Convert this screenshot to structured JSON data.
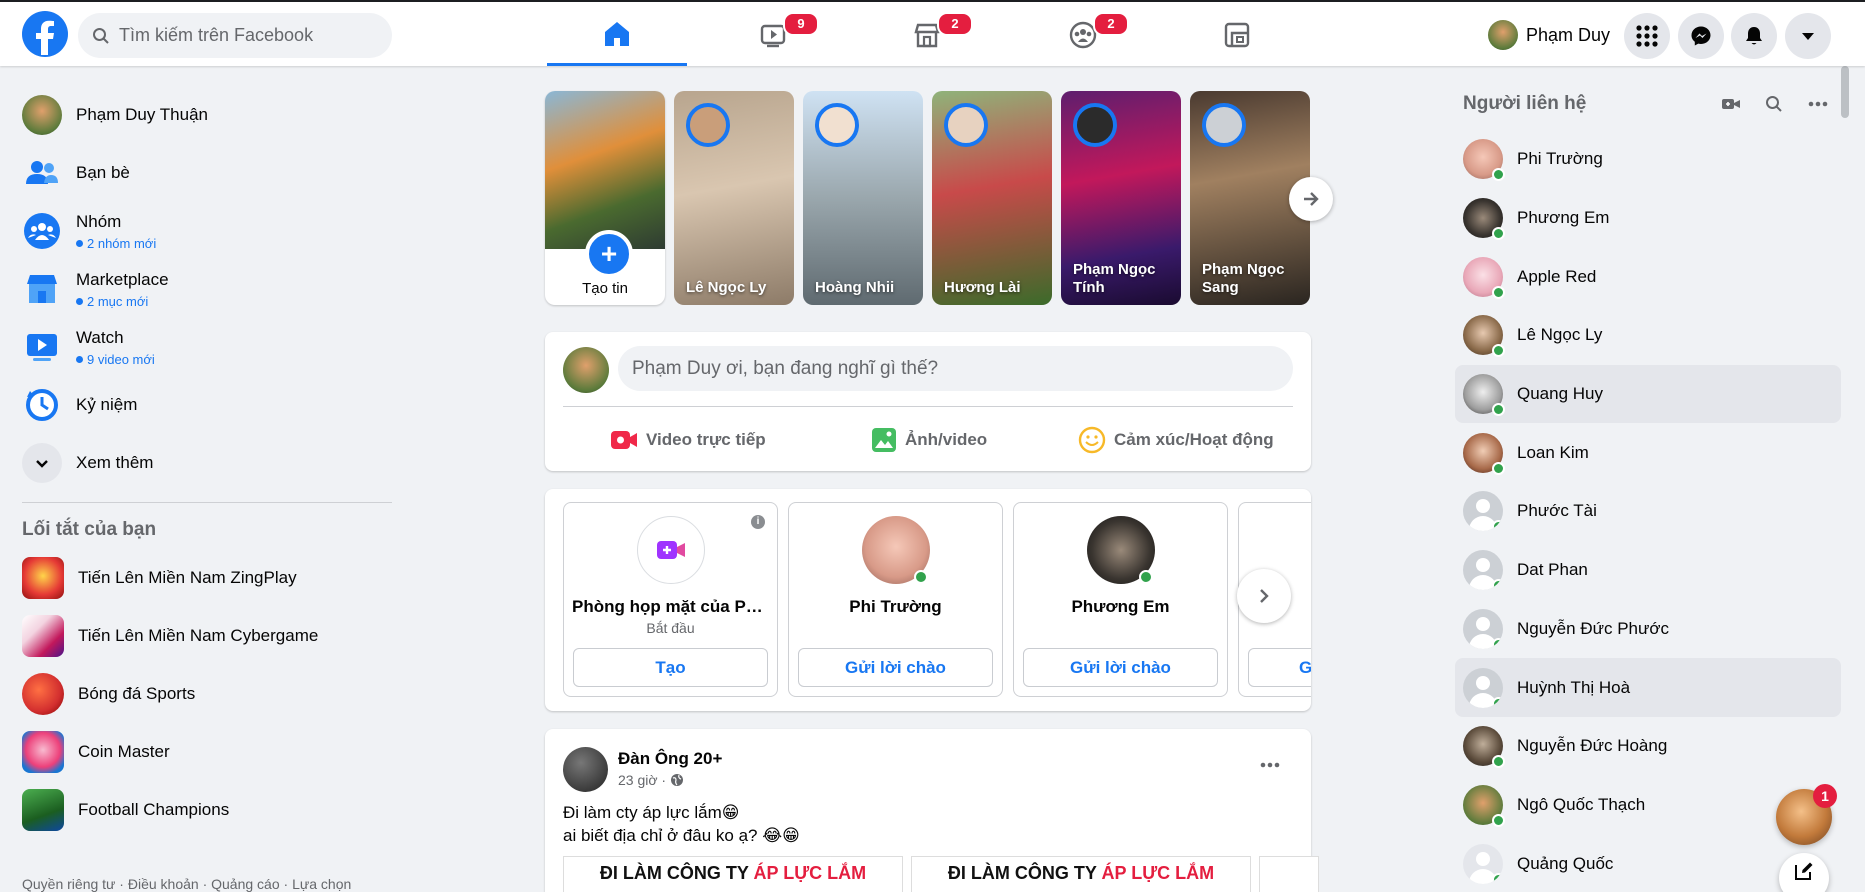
{
  "colors": {
    "brand": "#1877f2",
    "badge": "#e41e3f",
    "online": "#31a24c",
    "muted": "#65676b"
  },
  "search": {
    "placeholder": "Tìm kiếm trên Facebook"
  },
  "nav": {
    "tabs": [
      {
        "icon": "home-icon",
        "badge": ""
      },
      {
        "icon": "watch-icon",
        "badge": "9"
      },
      {
        "icon": "marketplace-icon",
        "badge": "2"
      },
      {
        "icon": "groups-icon",
        "badge": "2"
      },
      {
        "icon": "gaming-icon",
        "badge": ""
      }
    ]
  },
  "profile": {
    "name": "Phạm Duy"
  },
  "left": {
    "user_name": "Phạm Duy Thuận",
    "items": [
      {
        "label": "Bạn bè",
        "sub": ""
      },
      {
        "label": "Nhóm",
        "sub": "2 nhóm mới"
      },
      {
        "label": "Marketplace",
        "sub": "2 mục mới"
      },
      {
        "label": "Watch",
        "sub": "9 video mới"
      },
      {
        "label": "Kỷ niệm",
        "sub": ""
      }
    ],
    "see_more": "Xem thêm",
    "shortcuts_title": "Lối tắt của bạn",
    "shortcuts": [
      "Tiến Lên Miền Nam ZingPlay",
      "Tiến Lên Miền Nam Cybergame",
      "Bóng đá Sports",
      "Coin Master",
      "Football Champions"
    ],
    "footer": "Quyền riêng tư · Điều khoản · Quảng cáo · Lựa chọn"
  },
  "stories": {
    "create_label": "Tạo tin",
    "items": [
      {
        "name": "Lê Ngọc Ly"
      },
      {
        "name": "Hoàng Nhii"
      },
      {
        "name": "Hương Lài"
      },
      {
        "name": "Phạm Ngọc Tính"
      },
      {
        "name": "Phạm Ngọc Sang"
      }
    ]
  },
  "composer": {
    "placeholder": "Phạm Duy ơi, bạn đang nghĩ gì thế?",
    "actions": [
      "Video trực tiếp",
      "Ảnh/video",
      "Cảm xúc/Hoạt động"
    ]
  },
  "rooms": {
    "cards": [
      {
        "name": "Phòng họp mặt của Ph...",
        "sub": "Bắt đầu",
        "button": "Tạo"
      },
      {
        "name": "Phi Trường",
        "sub": "",
        "button": "Gửi lời chào"
      },
      {
        "name": "Phương Em",
        "sub": "",
        "button": "Gửi lời chào"
      },
      {
        "name": "",
        "sub": "",
        "button": "G"
      }
    ]
  },
  "post": {
    "author": "Đàn Ông 20+",
    "time": "23 giờ ·",
    "line1": "Đi làm cty áp lực lắm😁",
    "line2": "ai biết địa chỉ ở đâu ko ạ? 😂😁",
    "image_text_a": "ĐI LÀM CÔNG TY ",
    "image_text_b": "ÁP LỰC LẮM"
  },
  "contacts": {
    "title": "Người liên hệ",
    "items": [
      {
        "name": "Phi Trường",
        "online": true
      },
      {
        "name": "Phương Em",
        "online": true
      },
      {
        "name": "Apple Red",
        "online": true
      },
      {
        "name": "Lê Ngọc Ly",
        "online": true
      },
      {
        "name": "Quang Huy",
        "online": true
      },
      {
        "name": "Loan Kim",
        "online": true
      },
      {
        "name": "Phước Tài",
        "online": true
      },
      {
        "name": "Dat Phan",
        "online": true
      },
      {
        "name": "Nguyễn Đức Phước",
        "online": true
      },
      {
        "name": "Huỳnh Thị Hoà",
        "online": true
      },
      {
        "name": "Nguyễn Đức Hoàng",
        "online": true
      },
      {
        "name": "Ngô Quốc Thạch",
        "online": true
      },
      {
        "name": "Quảng Quốc",
        "online": true
      }
    ]
  },
  "chat": {
    "badge": "1"
  }
}
